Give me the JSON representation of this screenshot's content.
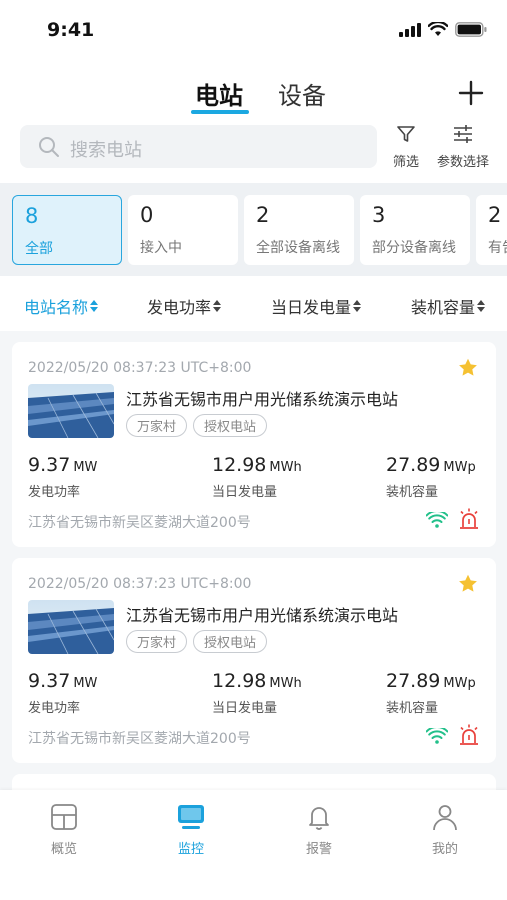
{
  "status_bar": {
    "time": "9:41"
  },
  "tabs": [
    {
      "label": "电站",
      "active": true
    },
    {
      "label": "设备",
      "active": false
    }
  ],
  "search": {
    "placeholder": "搜索电站"
  },
  "tools": {
    "filter_label": "筛选",
    "params_label": "参数选择"
  },
  "chips": [
    {
      "count": "8",
      "label": "全部",
      "active": true
    },
    {
      "count": "0",
      "label": "接入中",
      "active": false
    },
    {
      "count": "2",
      "label": "全部设备离线",
      "active": false
    },
    {
      "count": "3",
      "label": "部分设备离线",
      "active": false
    },
    {
      "count": "2",
      "label": "有告警",
      "active": false
    }
  ],
  "sort_columns": [
    {
      "label": "电站名称",
      "active": true
    },
    {
      "label": "发电功率",
      "active": false
    },
    {
      "label": "当日发电量",
      "active": false
    },
    {
      "label": "装机容量",
      "active": false
    }
  ],
  "stations": [
    {
      "datetime": "2022/05/20 08:37:23 UTC+8:00",
      "name": "江苏省无锡市用户用光储系统演示电站",
      "favorite": true,
      "tags": [
        "万家村",
        "授权电站"
      ],
      "power": {
        "value": "9.37",
        "unit": "MW",
        "label": "发电功率"
      },
      "daily": {
        "value": "12.98",
        "unit": "MWh",
        "label": "当日发电量"
      },
      "capacity": {
        "value": "27.89",
        "unit": "MWp",
        "label": "装机容量"
      },
      "address": "江苏省无锡市新吴区菱湖大道200号"
    },
    {
      "datetime": "2022/05/20 08:37:23 UTC+8:00",
      "name": "江苏省无锡市用户用光储系统演示电站",
      "favorite": true,
      "tags": [
        "万家村",
        "授权电站"
      ],
      "power": {
        "value": "9.37",
        "unit": "MW",
        "label": "发电功率"
      },
      "daily": {
        "value": "12.98",
        "unit": "MWh",
        "label": "当日发电量"
      },
      "capacity": {
        "value": "27.89",
        "unit": "MWp",
        "label": "装机容量"
      },
      "address": "江苏省无锡市新吴区菱湖大道200号"
    }
  ],
  "bottom_nav": [
    {
      "label": "概览",
      "icon": "overview-icon",
      "active": false
    },
    {
      "label": "监控",
      "icon": "monitor-icon",
      "active": true
    },
    {
      "label": "报警",
      "icon": "bell-icon",
      "active": false
    },
    {
      "label": "我的",
      "icon": "user-icon",
      "active": false
    }
  ],
  "colors": {
    "accent": "#1ba1dc",
    "star": "#f5c132",
    "wifi": "#22c08a",
    "alarm": "#e8413b"
  }
}
